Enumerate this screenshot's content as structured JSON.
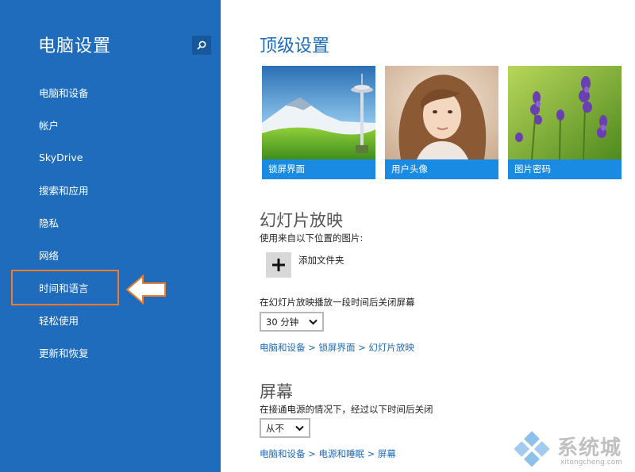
{
  "sidebar": {
    "title": "电脑设置",
    "search_icon": "search-icon",
    "items": [
      {
        "label": "电脑和设备"
      },
      {
        "label": "帐户"
      },
      {
        "label": "SkyDrive"
      },
      {
        "label": "搜索和应用"
      },
      {
        "label": "隐私"
      },
      {
        "label": "网络"
      },
      {
        "label": "时间和语言",
        "highlighted": true
      },
      {
        "label": "轻松使用"
      },
      {
        "label": "更新和恢复"
      }
    ]
  },
  "main": {
    "title": "顶级设置",
    "tiles": [
      {
        "label": "锁屏界面"
      },
      {
        "label": "用户头像"
      },
      {
        "label": "图片密码"
      }
    ],
    "slideshow": {
      "title": "幻灯片放映",
      "source_label": "使用来自以下位置的图片:",
      "add_folder_label": "添加文件夹",
      "turn_off_label": "在幻灯片放映播放一段时间后关闭屏幕",
      "turn_off_value": "30 分钟",
      "breadcrumb": "电脑和设备 > 锁屏界面 > 幻灯片放映"
    },
    "screen": {
      "title": "屏幕",
      "plugged_label": "在接通电源的情况下，经过以下时间后关闭",
      "plugged_value": "从不",
      "breadcrumb": "电脑和设备 > 电源和睡眠 > 屏幕"
    }
  },
  "watermark": {
    "text": "系统城",
    "url": "xitongcheng.com"
  },
  "colors": {
    "sidebar_bg": "#1e6cbb",
    "accent": "#1e6cbb",
    "tile_label_bg": "#1a8be3",
    "highlight": "#f07d2a"
  }
}
